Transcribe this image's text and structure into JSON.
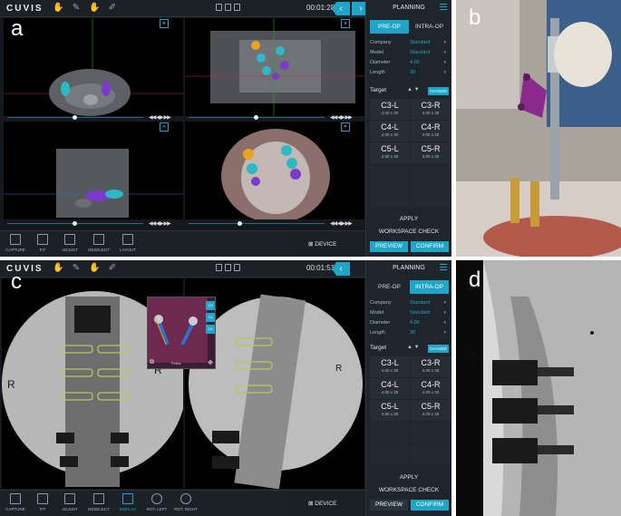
{
  "panels": {
    "a": {
      "letter": "a",
      "timer": "00:01:28"
    },
    "b": {
      "letter": "b"
    },
    "c": {
      "letter": "c",
      "timer": "00:01:51"
    },
    "d": {
      "letter": "d"
    }
  },
  "app": {
    "logo": "CUVIS",
    "planning_title": "PLANNING",
    "tabs": {
      "preop": "PRE-OP",
      "intraop": "INTRA-OP"
    },
    "props": [
      {
        "key": "Company",
        "value": "Standard"
      },
      {
        "key": "Model",
        "value": "Standard"
      },
      {
        "key": "Diameter",
        "value": "4.00"
      },
      {
        "key": "Length",
        "value": "30"
      }
    ],
    "target_label": "Target",
    "change_label": "CHANGE",
    "screws": [
      {
        "name": "C3-L",
        "size": "4.00 x 30"
      },
      {
        "name": "C3-R",
        "size": "4.00 x 30"
      },
      {
        "name": "C4-L",
        "size": "4.00 x 30"
      },
      {
        "name": "C4-R",
        "size": "4.00 x 30"
      },
      {
        "name": "C5-L",
        "size": "4.00 x 30"
      },
      {
        "name": "C5-R",
        "size": "4.00 x 30"
      }
    ],
    "apply": "APPLY",
    "workspace_check": "WORKSPACE CHECK",
    "preview": "PREVIEW",
    "confirm": "CONFIRM",
    "device": "DEVICE",
    "tools_a": [
      "CAPTURE",
      "FIT",
      "ADJUST",
      "DESELECT",
      "LAYOUT"
    ],
    "tools_c": [
      "CAPTURE",
      "FIT",
      "ADJUST",
      "DESELECT",
      "DISPLAY",
      "ROT. LEFT",
      "ROT. RIGHT"
    ],
    "orient_labels": {
      "top": "P",
      "left": "L",
      "right": "R",
      "bottom": "A",
      "s": "S",
      "i": "I"
    },
    "inset_labels": [
      "C3",
      "C4",
      "C5"
    ],
    "inset_caption": "Probe",
    "xray_marks": [
      "R",
      "R",
      "R"
    ]
  },
  "colors": {
    "accent": "#1ea5c7",
    "screw_green": "#b8c85a",
    "screw_purple": "#7a3cc8",
    "screw_cyan": "#2fb7c8"
  }
}
